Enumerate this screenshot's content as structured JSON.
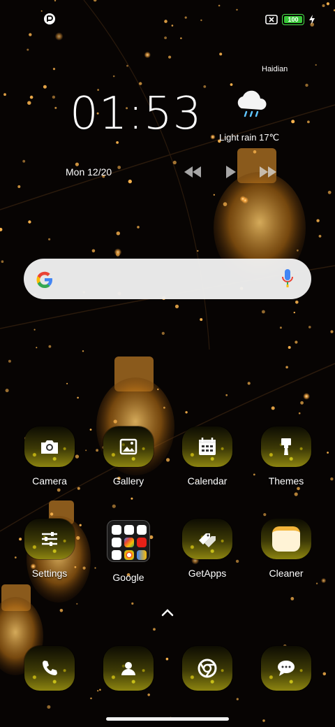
{
  "status_bar": {
    "battery_percent": "100"
  },
  "clock_widget": {
    "time": "01:53",
    "date": "Mon 12/20",
    "city": "Haidian",
    "weather": "Light rain  17℃",
    "weather_icon": "rain-cloud-icon"
  },
  "search_bar": {
    "logo": "google-g-icon",
    "mic": "microphone-icon"
  },
  "apps_row1": [
    {
      "label": "Camera",
      "icon": "camera-icon"
    },
    {
      "label": "Gallery",
      "icon": "image-icon"
    },
    {
      "label": "Calendar",
      "icon": "calendar-icon"
    },
    {
      "label": "Themes",
      "icon": "paintbrush-icon"
    }
  ],
  "apps_row2": [
    {
      "label": "Settings",
      "icon": "sliders-icon"
    },
    {
      "label": "Google",
      "icon": "folder-icon"
    },
    {
      "label": "GetApps",
      "icon": "tags-icon"
    },
    {
      "label": "Cleaner",
      "icon": "cleaner-icon"
    }
  ],
  "dock": [
    {
      "icon": "phone-icon"
    },
    {
      "icon": "contacts-icon"
    },
    {
      "icon": "chrome-icon"
    },
    {
      "icon": "messages-icon"
    }
  ],
  "colors": {
    "accent": "#f0a43a",
    "battery": "#38c738"
  }
}
